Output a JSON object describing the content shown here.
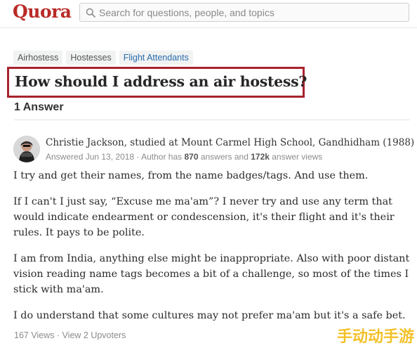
{
  "header": {
    "logo": "Quora",
    "search_placeholder": "Search for questions, people, and topics"
  },
  "topics": [
    "Airhostess",
    "Hostesses",
    "Flight Attendants"
  ],
  "question": {
    "title": "How should I address an air hostess?",
    "answer_count": "1 Answer"
  },
  "answer": {
    "author_name": "Christie Jackson, studied at Mount Carmel High School, Gandhidham (1988)",
    "meta_prefix": "Answered Jun 13, 2018 · Author has ",
    "answers_count": "870",
    "meta_mid": " answers and ",
    "views_count": "172k",
    "meta_suffix": " answer views",
    "paragraphs": [
      "I try and get their names, from the name badges/tags. And use them.",
      "If I can't I just say, “Excuse me ma'am”? I never try and use any term that would indicate endearment or condescension, it's their flight and it's their rules. It pays to be polite.",
      "I am from India, anything else might be inappropriate. Also with poor distant vision reading name tags becomes a bit of a challenge, so most of the times I stick with ma'am.",
      "I do understand that some cultures may not prefer ma'am but it's a safe bet."
    ],
    "footer": "167 Views · View 2 Upvoters"
  },
  "watermark": "手动动手游",
  "colors": {
    "brand": "#b92b27",
    "highlight_border": "#a8232e",
    "topic_link": "#2b6dad"
  }
}
